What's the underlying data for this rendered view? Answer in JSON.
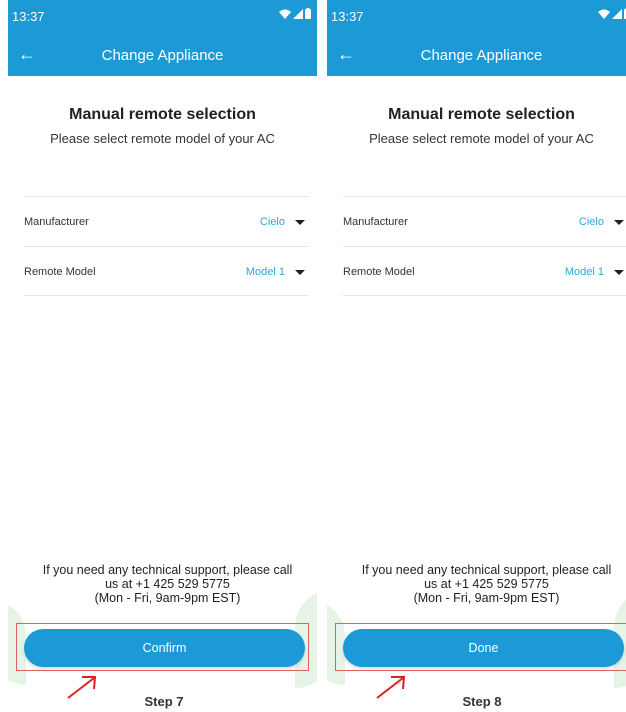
{
  "screens": [
    {
      "status_time": "13:37",
      "header_title": "Change Appliance",
      "selection_title": "Manual remote selection",
      "selection_subtitle": "Please select remote model of your AC",
      "manufacturer_label": "Manufacturer",
      "manufacturer_value": "Cielo",
      "remote_model_label": "Remote Model",
      "remote_model_value": "Model 1",
      "support_line1": "If you need any technical support, please call",
      "support_line2": "us at +1 425 529 5775",
      "support_line3": "(Mon - Fri, 9am-9pm EST)",
      "button_label": "Confirm"
    },
    {
      "status_time": "13:37",
      "header_title": "Change Appliance",
      "selection_title": "Manual remote selection",
      "selection_subtitle": "Please select remote model of your AC",
      "manufacturer_label": "Manufacturer",
      "manufacturer_value": "Cielo",
      "remote_model_label": "Remote Model",
      "remote_model_value": "Model 1",
      "support_line1": "If you need any technical support, please call",
      "support_line2": "us at +1 425 529 5775",
      "support_line3": "(Mon - Fri, 9am-9pm EST)",
      "button_label": "Done"
    }
  ],
  "steps": [
    "Step 7",
    "Step 8"
  ],
  "icons": {
    "back": "back-arrow-icon",
    "wifi": "wifi-icon",
    "signal": "signal-icon",
    "battery": "battery-icon",
    "dropdown": "caret-down-icon",
    "annotation": "red-arrow-icon"
  },
  "colors": {
    "header": "#1b9ad6",
    "button": "#1c9ad8",
    "value_text": "#29a8d8",
    "highlight_border": "#e06060",
    "leaf": "#e5f4e7"
  }
}
